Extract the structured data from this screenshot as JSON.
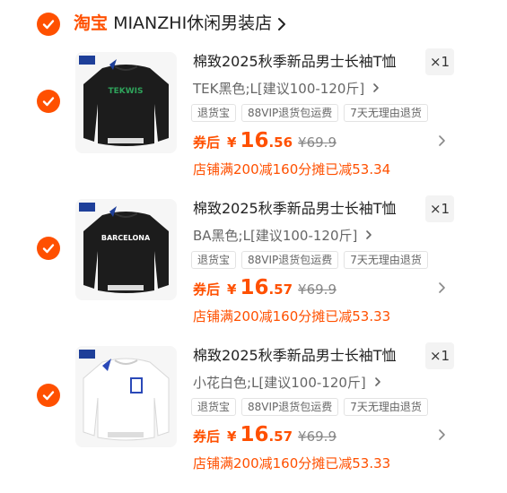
{
  "colors": {
    "accent": "#ff5000",
    "check_fill": "#ff5000"
  },
  "shop": {
    "brand": "淘宝",
    "name": "MIANZHI休闲男装店"
  },
  "items": [
    {
      "title": "棉致2025秋季新品男士长袖T恤",
      "qty": "×1",
      "variant": "TEK黑色;L[建议100-120斤]",
      "tags": [
        "退货宝",
        "88VIP退货包运费",
        "7天无理由退货"
      ],
      "price_label": "券后",
      "currency": "¥",
      "price_int": "16",
      "price_dec": ".56",
      "price_orig": "¥69.9",
      "promo": "店铺满200减160分摊已减53.34",
      "thumb_print": "TEKWIS",
      "shirt_color": "#1c1c1c"
    },
    {
      "title": "棉致2025秋季新品男士长袖T恤",
      "qty": "×1",
      "variant": "BA黑色;L[建议100-120斤]",
      "tags": [
        "退货宝",
        "88VIP退货包运费",
        "7天无理由退货"
      ],
      "price_label": "券后",
      "currency": "¥",
      "price_int": "16",
      "price_dec": ".57",
      "price_orig": "¥69.9",
      "promo": "店铺满200减160分摊已减53.33",
      "thumb_print": "BARCELONA",
      "shirt_color": "#1c1c1c"
    },
    {
      "title": "棉致2025秋季新品男士长袖T恤",
      "qty": "×1",
      "variant": "小花白色;L[建议100-120斤]",
      "tags": [
        "退货宝",
        "88VIP退货包运费",
        "7天无理由退货"
      ],
      "price_label": "券后",
      "currency": "¥",
      "price_int": "16",
      "price_dec": ".57",
      "price_orig": "¥69.9",
      "promo": "店铺满200减160分摊已减53.33",
      "thumb_print": "",
      "shirt_color": "#f4f4f4"
    }
  ]
}
